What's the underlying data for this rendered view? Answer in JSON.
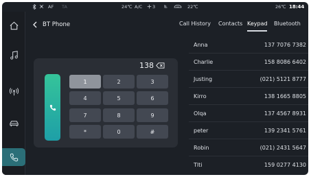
{
  "status_bar": {
    "left_items": [
      "AF",
      "TA"
    ],
    "temp_left": "24℃",
    "ac_label": "A/C",
    "fan_level": "3",
    "temp_right_climate": "22℃",
    "outside_temp": "26℃",
    "time": "18:44"
  },
  "sidebar": {
    "items": [
      {
        "icon": "home-icon"
      },
      {
        "icon": "music-icon"
      },
      {
        "icon": "radio-icon"
      },
      {
        "icon": "car-icon"
      },
      {
        "icon": "phone-icon",
        "active": true
      }
    ]
  },
  "header": {
    "back_label": "BT Phone"
  },
  "tabs": [
    {
      "label": "Call History"
    },
    {
      "label": "Contacts"
    },
    {
      "label": "Keypad",
      "active": true
    },
    {
      "label": "Bluetooth"
    }
  ],
  "keypad": {
    "display": "138",
    "keys": [
      "1",
      "2",
      "3",
      "4",
      "5",
      "6",
      "7",
      "8",
      "9",
      "*",
      "0",
      "#"
    ],
    "pressed_key": "1"
  },
  "contacts": [
    {
      "name": "Anna",
      "number": "137 7076 7382"
    },
    {
      "name": "Charlie",
      "number": "158 8086 6402"
    },
    {
      "name": "Justing",
      "number": "(021) 5121 8777"
    },
    {
      "name": "Kirro",
      "number": "138 1665 8805"
    },
    {
      "name": "Olqa",
      "number": "137 4567 8931"
    },
    {
      "name": "peter",
      "number": "139 2341 5761"
    },
    {
      "name": "Robin",
      "number": "(021) 2431 5647"
    },
    {
      "name": "Tlti",
      "number": "159 0277 4130"
    }
  ],
  "colors": {
    "background": "#1c2026",
    "panel": "#2a2e35",
    "key": "#434852",
    "key_pressed": "#8f949c",
    "call_gradient_top": "#35c49a",
    "call_gradient_bottom": "#1e9fa7",
    "sidebar_active": "#2b6f78"
  }
}
